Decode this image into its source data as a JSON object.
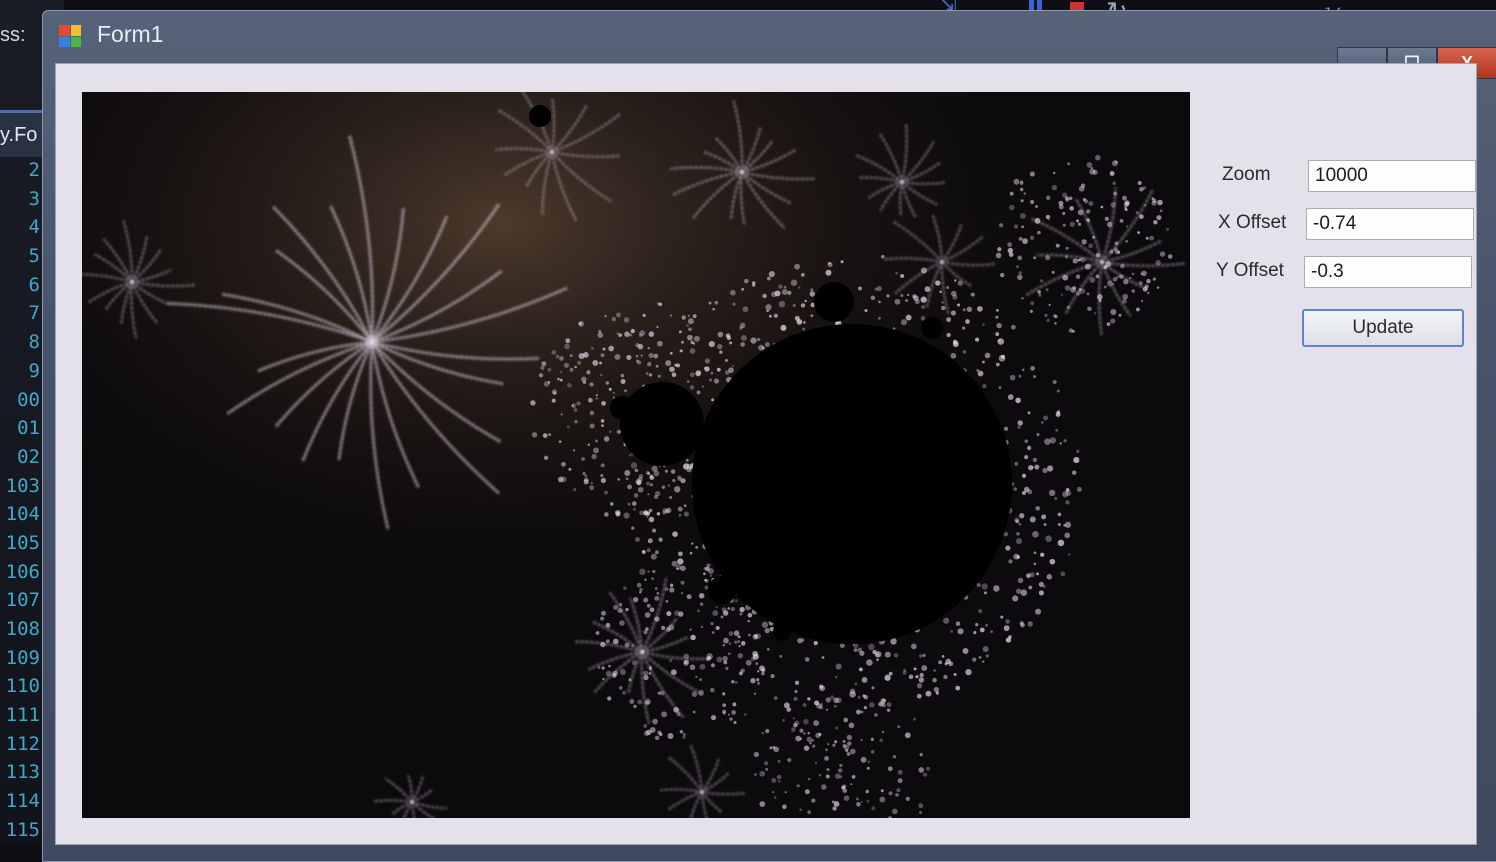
{
  "ide": {
    "panel_label": "ss:",
    "tab_label": "y.Fo",
    "fold_marker": "⊟",
    "line_numbers": [
      "2",
      "3",
      "4",
      "5",
      "6",
      "7",
      "8",
      "9",
      "00",
      "01",
      "02",
      "103",
      "104",
      "105",
      "106",
      "107",
      "108",
      "109",
      "110",
      "111",
      "112",
      "113",
      "114",
      "115"
    ],
    "changed_lines": [
      "104",
      "108",
      "109",
      "110",
      "111",
      "115"
    ],
    "colors": {
      "line_number": "#3fa9c9",
      "change_marker": "#57a52d"
    },
    "toolbar_icons": [
      "step-icon",
      "pause-icon",
      "stop-icon",
      "restart-icon",
      "misc-icon"
    ]
  },
  "window": {
    "title": "Form1",
    "icon": "app-icon",
    "caption_buttons": {
      "minimize": "▁",
      "maximize": "☐",
      "close": "X"
    }
  },
  "form": {
    "zoom": {
      "label": "Zoom",
      "value": "10000"
    },
    "x_offset": {
      "label": "X Offset",
      "value": "-0.74"
    },
    "y_offset": {
      "label": "Y Offset",
      "value": "-0.3"
    },
    "update_label": "Update"
  },
  "fractal": {
    "description_icon": "mandelbrot-render",
    "colors": {
      "background": "#0c0a0c",
      "filaments": "#e9dcef",
      "interior": "#000000"
    }
  }
}
